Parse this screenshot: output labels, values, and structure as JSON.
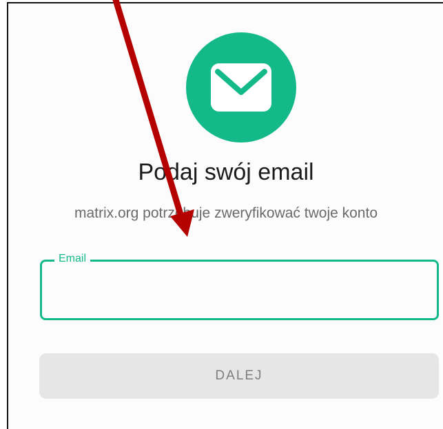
{
  "colors": {
    "accent": "#14b98a",
    "annotation_arrow": "#b50000"
  },
  "header": {
    "icon": "envelope-icon"
  },
  "title": "Podaj swój email",
  "subtitle": "matrix.org potrzebuje zweryfikować twoje konto",
  "email_field": {
    "label": "Email",
    "value": "",
    "placeholder": ""
  },
  "next_button": {
    "label": "DALEJ",
    "enabled": false
  }
}
